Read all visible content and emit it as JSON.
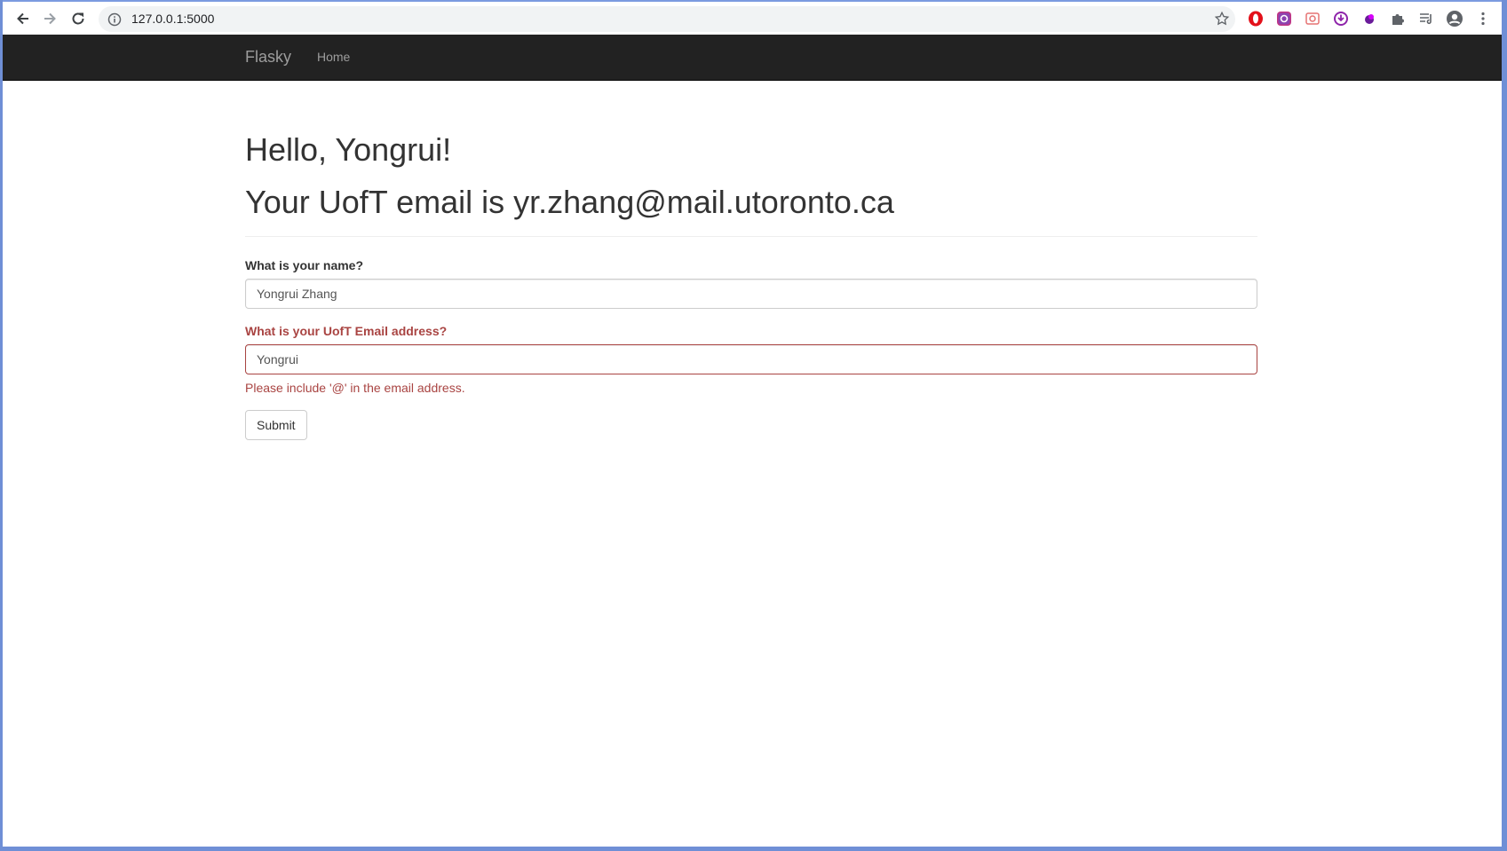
{
  "browser": {
    "url": "127.0.0.1:5000",
    "icons": [
      "back-icon",
      "forward-icon",
      "reload-icon",
      "info-icon",
      "bookmark-star-icon",
      "extension-opera-icon",
      "extension-instagram-icon",
      "extension-screenshot-icon",
      "extension-download-icon",
      "extension-purple-icon",
      "extensions-puzzle-icon",
      "reading-list-icon",
      "profile-icon",
      "menu-icon"
    ]
  },
  "navbar": {
    "brand": "Flasky",
    "home": "Home"
  },
  "page": {
    "greeting": "Hello, Yongrui!",
    "email_line": "Your UofT email is yr.zhang@mail.utoronto.ca"
  },
  "form": {
    "name_label": "What is your name?",
    "name_value": "Yongrui Zhang",
    "email_label": "What is your UofT Email address?",
    "email_value": "Yongrui",
    "email_error": "Please include '@' in the email address.",
    "submit_label": "Submit"
  },
  "colors": {
    "navbar_bg": "#222222",
    "error": "#a94442",
    "text": "#333333"
  }
}
